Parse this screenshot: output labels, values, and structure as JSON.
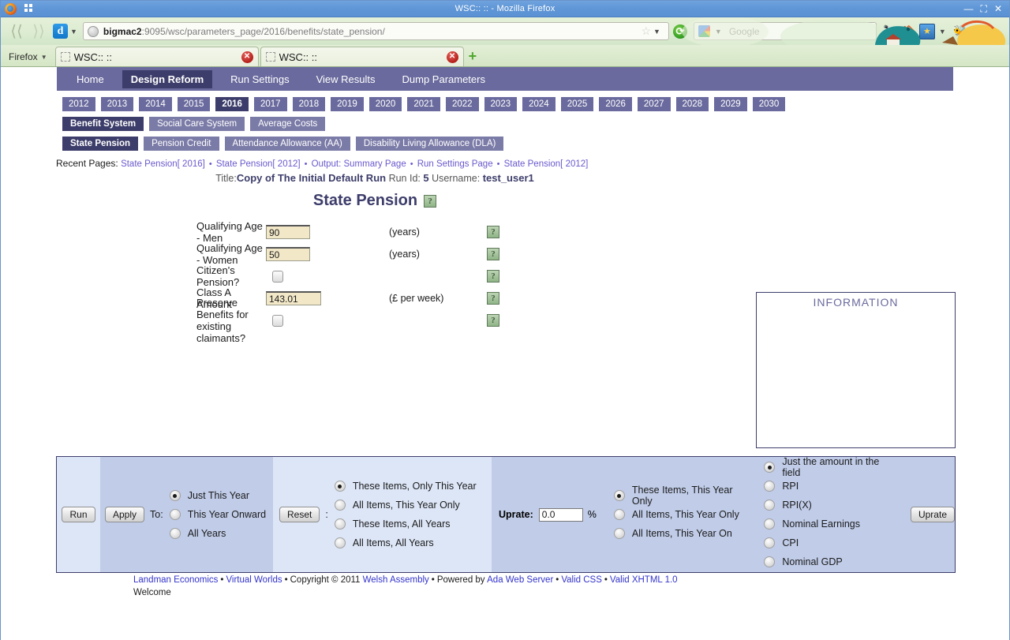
{
  "window": {
    "title": "WSC::  :: - Mozilla Firefox",
    "minimize": "—",
    "maximize": "⛶",
    "close": "✕"
  },
  "browser": {
    "back_icon": "back-arrow",
    "forward_icon": "forward-arrow",
    "download_icon": "d",
    "url_host": "bigmac2",
    "url_rest": ":9095/wsc/parameters_page/2016/benefits/state_pension/",
    "url_full": "bigmac2:9095/wsc/parameters_page/2016/benefits/state_pension/",
    "star_icon": "☆",
    "reload_icon": "⟳",
    "search_placeholder": "Google",
    "firefox_menu": "Firefox",
    "tabs": [
      {
        "label": "WSC::  ::",
        "close": "✕"
      },
      {
        "label": "WSC::  ::",
        "close": "✕"
      }
    ],
    "new_tab": "+"
  },
  "mainnav": [
    {
      "label": "Home",
      "active": false
    },
    {
      "label": "Design Reform",
      "active": true
    },
    {
      "label": "Run Settings",
      "active": false
    },
    {
      "label": "View Results",
      "active": false
    },
    {
      "label": "Dump Parameters",
      "active": false
    }
  ],
  "years": [
    {
      "label": "2012",
      "active": false
    },
    {
      "label": "2013",
      "active": false
    },
    {
      "label": "2014",
      "active": false
    },
    {
      "label": "2015",
      "active": false
    },
    {
      "label": "2016",
      "active": true
    },
    {
      "label": "2017",
      "active": false
    },
    {
      "label": "2018",
      "active": false
    },
    {
      "label": "2019",
      "active": false
    },
    {
      "label": "2020",
      "active": false
    },
    {
      "label": "2021",
      "active": false
    },
    {
      "label": "2022",
      "active": false
    },
    {
      "label": "2023",
      "active": false
    },
    {
      "label": "2024",
      "active": false
    },
    {
      "label": "2025",
      "active": false
    },
    {
      "label": "2026",
      "active": false
    },
    {
      "label": "2027",
      "active": false
    },
    {
      "label": "2028",
      "active": false
    },
    {
      "label": "2029",
      "active": false
    },
    {
      "label": "2030",
      "active": false
    }
  ],
  "systems": [
    {
      "label": "Benefit System",
      "active": true
    },
    {
      "label": "Social Care System",
      "active": false
    },
    {
      "label": "Average Costs",
      "active": false
    }
  ],
  "benefits": [
    {
      "label": "State Pension",
      "active": true
    },
    {
      "label": "Pension Credit",
      "active": false
    },
    {
      "label": "Attendance Allowance (AA)",
      "active": false
    },
    {
      "label": "Disability Living Allowance (DLA)",
      "active": false
    }
  ],
  "recent": {
    "label": "Recent Pages:",
    "items": [
      "State Pension[ 2016]",
      "State Pension[ 2012]",
      "Output: Summary Page",
      "Run Settings Page",
      "State Pension[ 2012]"
    ],
    "separator": "•"
  },
  "runinfo": {
    "title_label": "Title:",
    "title_value": "Copy of The Initial Default Run",
    "runid_label": "Run Id:",
    "runid_value": "5",
    "username_label": "Username:",
    "username_value": "test_user1"
  },
  "page_title": "State Pension",
  "help_glyph": "?",
  "fields": [
    {
      "label": "Qualifying Age - Men",
      "type": "text",
      "value": "90",
      "unit": "(years)"
    },
    {
      "label": "Qualifying Age - Women",
      "type": "text",
      "value": "50",
      "unit": "(years)"
    },
    {
      "label": "Citizen's Pension?",
      "type": "checkbox",
      "value": "",
      "unit": ""
    },
    {
      "label": "Class A Amount",
      "type": "text",
      "value": "143.01",
      "unit": "(£ per week)"
    },
    {
      "label": "Preserve Benefits for existing claimants?",
      "type": "checkbox",
      "value": "",
      "unit": ""
    }
  ],
  "information": {
    "heading": "INFORMATION",
    "body": ""
  },
  "controls": {
    "run_label": "Run",
    "apply_label": "Apply",
    "to_label": "To:",
    "apply_options": [
      {
        "label": "Just This Year",
        "selected": true
      },
      {
        "label": "This Year Onward",
        "selected": false
      },
      {
        "label": "All Years",
        "selected": false
      }
    ],
    "reset_label": "Reset",
    "reset_colon": ":",
    "reset_options": [
      {
        "label": "These Items, Only This Year",
        "selected": true
      },
      {
        "label": "All Items, This Year Only",
        "selected": false
      },
      {
        "label": "These Items, All Years",
        "selected": false
      },
      {
        "label": "All Items, All Years",
        "selected": false
      }
    ],
    "uprate_label": "Uprate:",
    "uprate_value": "0.0",
    "percent_sign": "%",
    "uprate_scope_options": [
      {
        "label": "These Items, This Year Only",
        "selected": true
      },
      {
        "label": "All Items, This Year Only",
        "selected": false
      },
      {
        "label": "All Items, This Year On",
        "selected": false
      }
    ],
    "uprate_index_options": [
      {
        "label": "Just the amount in the field",
        "selected": true
      },
      {
        "label": "RPI",
        "selected": false
      },
      {
        "label": "RPI(X)",
        "selected": false
      },
      {
        "label": "Nominal Earnings",
        "selected": false
      },
      {
        "label": "CPI",
        "selected": false
      },
      {
        "label": "Nominal GDP",
        "selected": false
      }
    ],
    "uprate_button": "Uprate"
  },
  "footer": {
    "landman": "Landman Economics",
    "virtual_worlds": "Virtual Worlds",
    "copyright": "Copyright © 2011",
    "welsh": "Welsh Assembly",
    "powered": "Powered by",
    "ada": "Ada Web Server",
    "validcss": "Valid CSS",
    "validxhtml": "Valid XHTML 1.0",
    "dot": "•",
    "welcome": "Welcome"
  },
  "colors": {
    "nav_purple": "#6a6a9e",
    "nav_active": "#3d3d6b",
    "panel_light": "#dde6f7",
    "panel_mid": "#c0cce8",
    "field_cream": "#f2e8c8",
    "link_purple": "#6a5acd",
    "footer_link": "#3333cc",
    "titlebar_blue": "#5b92d4"
  }
}
